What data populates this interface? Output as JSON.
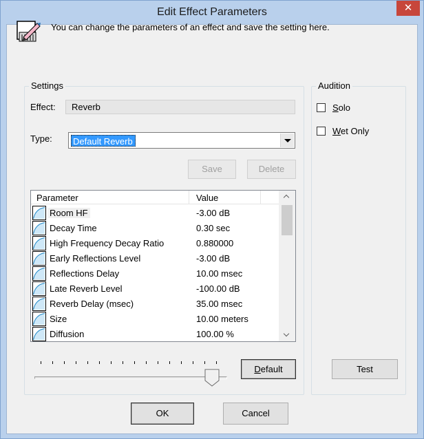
{
  "window": {
    "title": "Edit Effect Parameters",
    "close_glyph": "✕"
  },
  "header": {
    "icon": "edit-parameters-icon",
    "text": "You can change the parameters of an effect and save the setting here."
  },
  "settings": {
    "group_label": "Settings",
    "effect_label": "Effect:",
    "effect_value": "Reverb",
    "type_label": "Type:",
    "type_value": "Default Reverb",
    "save_label": "Save",
    "delete_label": "Delete"
  },
  "parameters": {
    "columns": {
      "parameter": "Parameter",
      "value": "Value"
    },
    "selected_index": 0,
    "rows": [
      {
        "name": "Room HF",
        "value": "-3.00 dB"
      },
      {
        "name": "Decay Time",
        "value": "0.30 sec"
      },
      {
        "name": "High Frequency Decay Ratio",
        "value": "0.880000"
      },
      {
        "name": "Early Reflections Level",
        "value": "-3.00 dB"
      },
      {
        "name": "Reflections Delay",
        "value": "10.00 msec"
      },
      {
        "name": "Late Reverb Level",
        "value": "-100.00 dB"
      },
      {
        "name": "Reverb Delay (msec)",
        "value": "35.00 msec"
      },
      {
        "name": "Size",
        "value": "10.00 meters"
      },
      {
        "name": "Diffusion",
        "value": "100.00 %"
      }
    ]
  },
  "slider": {
    "position_fraction": 0.92,
    "tick_count": 16
  },
  "default_button": {
    "label_prefix": "",
    "label_mnemonic": "D",
    "label_rest": "efault"
  },
  "audition": {
    "group_label": "Audition",
    "solo": {
      "mnemonic": "S",
      "rest": "olo",
      "checked": false
    },
    "wet_only": {
      "mnemonic": "W",
      "rest": "et Only",
      "checked": false
    },
    "test_label": "Test"
  },
  "footer": {
    "ok_label": "OK",
    "cancel_label": "Cancel"
  },
  "colors": {
    "title_bar": "#b9d0ec",
    "close": "#c7463b",
    "selection": "#3399ff",
    "client": "#f0f0f0"
  }
}
